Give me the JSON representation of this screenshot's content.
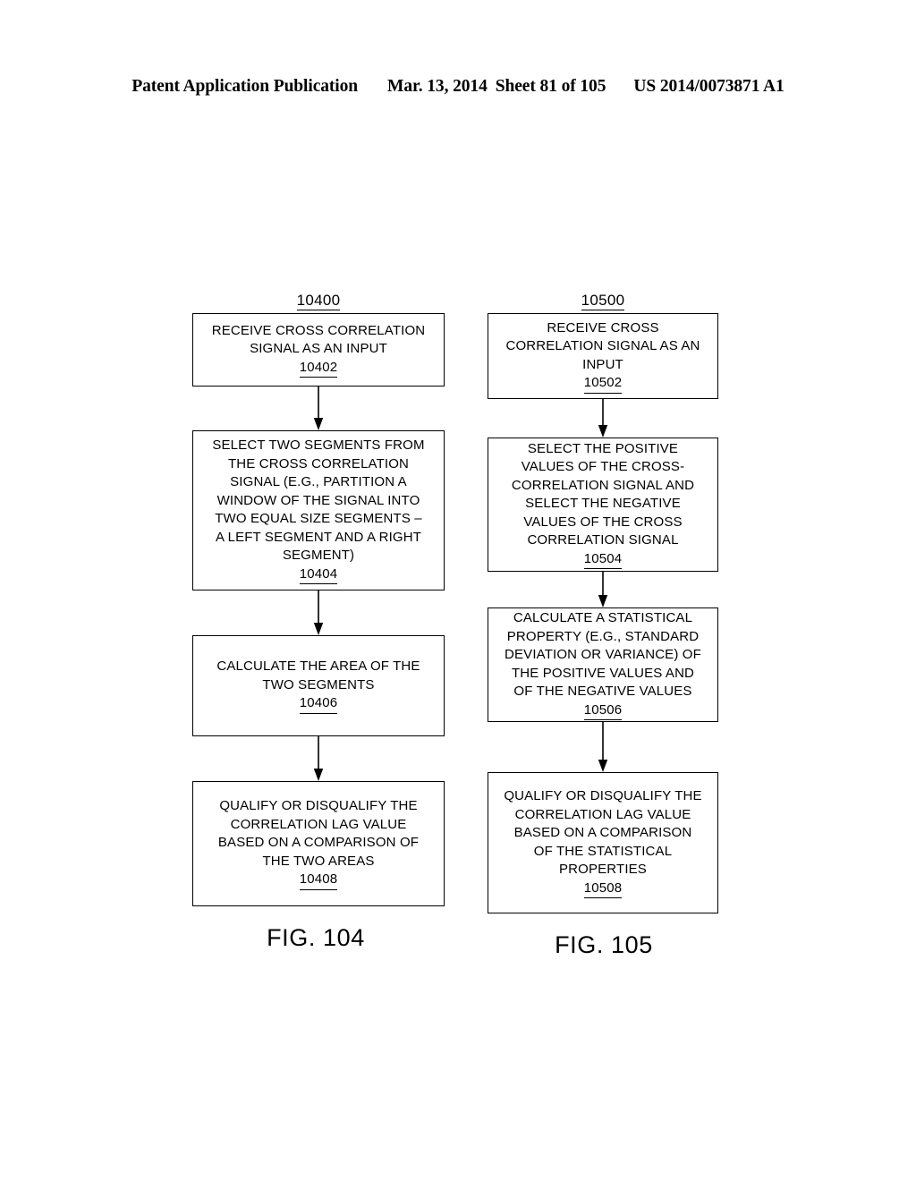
{
  "header": {
    "publication": "Patent Application Publication",
    "date": "Mar. 13, 2014",
    "sheet": "Sheet 81 of 105",
    "patent_number": "US 2014/0073871 A1"
  },
  "figures": [
    {
      "id": "fig-104",
      "diagram_ref": "10400",
      "caption": "FIG. 104",
      "steps": [
        {
          "ref": "10402",
          "lines": [
            "RECEIVE CROSS CORRELATION",
            "SIGNAL AS AN INPUT"
          ]
        },
        {
          "ref": "10404",
          "lines": [
            "SELECT TWO SEGMENTS FROM",
            "THE CROSS CORRELATION",
            "SIGNAL (E.G., PARTITION A",
            "WINDOW OF THE SIGNAL INTO",
            "TWO EQUAL SIZE SEGMENTS –",
            "A LEFT SEGMENT AND A RIGHT",
            "SEGMENT)"
          ]
        },
        {
          "ref": "10406",
          "lines": [
            "CALCULATE THE AREA OF THE",
            "TWO SEGMENTS"
          ]
        },
        {
          "ref": "10408",
          "lines": [
            "QUALIFY OR DISQUALIFY THE",
            "CORRELATION LAG VALUE",
            "BASED ON A COMPARISON OF",
            "THE TWO AREAS"
          ]
        }
      ]
    },
    {
      "id": "fig-105",
      "diagram_ref": "10500",
      "caption": "FIG. 105",
      "steps": [
        {
          "ref": "10502",
          "lines": [
            "RECEIVE CROSS",
            "CORRELATION SIGNAL AS AN",
            "INPUT"
          ]
        },
        {
          "ref": "10504",
          "lines": [
            "SELECT THE POSITIVE",
            "VALUES OF THE CROSS-",
            "CORRELATION SIGNAL AND",
            "SELECT THE NEGATIVE",
            "VALUES OF THE CROSS",
            "CORRELATION SIGNAL"
          ]
        },
        {
          "ref": "10506",
          "lines": [
            "CALCULATE A STATISTICAL",
            "PROPERTY (E.G., STANDARD",
            "DEVIATION OR VARIANCE)  OF",
            "THE POSITIVE VALUES AND",
            "OF THE NEGATIVE VALUES"
          ]
        },
        {
          "ref": "10508",
          "lines": [
            "QUALIFY OR DISQUALIFY THE",
            "CORRELATION LAG VALUE",
            "BASED ON A COMPARISON",
            "OF THE STATISTICAL",
            "PROPERTIES"
          ]
        }
      ]
    }
  ],
  "colors": {
    "ink": "#000000",
    "paper": "#ffffff"
  }
}
